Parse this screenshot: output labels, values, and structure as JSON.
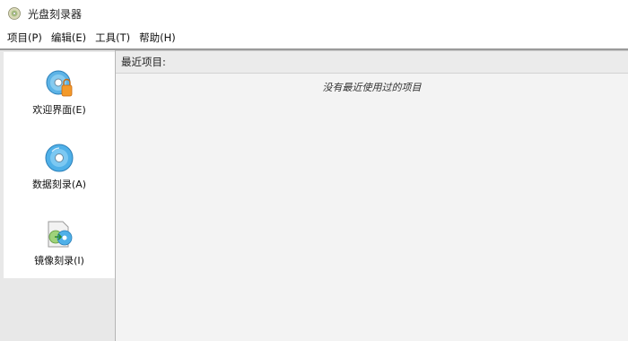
{
  "window": {
    "title": "光盘刻录器",
    "icon": "disc-burner-app-icon"
  },
  "menu": [
    {
      "label": "项目(P)"
    },
    {
      "label": "编辑(E)"
    },
    {
      "label": "工具(T)"
    },
    {
      "label": "帮助(H)"
    }
  ],
  "sidebar": {
    "items": [
      {
        "label": "欢迎界面(E)",
        "icon": "welcome-disc-icon"
      },
      {
        "label": "数据刻录(A)",
        "icon": "data-disc-icon"
      },
      {
        "label": "镜像刻录(I)",
        "icon": "image-burn-icon"
      }
    ]
  },
  "recent": {
    "title": "最近项目:",
    "empty_text": "没有最近使用过的项目"
  }
}
